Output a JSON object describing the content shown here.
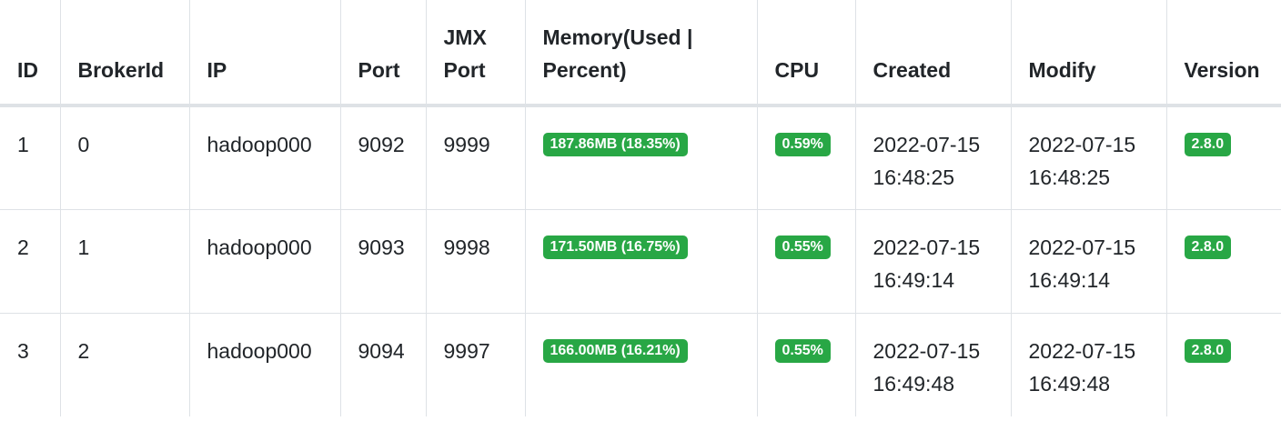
{
  "table": {
    "headers": {
      "id": "ID",
      "broker_id": "BrokerId",
      "ip": "IP",
      "port": "Port",
      "jmx_port": "JMX\nPort",
      "memory": "Memory(Used |\nPercent)",
      "cpu": "CPU",
      "created": "Created",
      "modify": "Modify",
      "version": "Version"
    },
    "rows": [
      {
        "id": "1",
        "broker_id": "0",
        "ip": "hadoop000",
        "port": "9092",
        "jmx_port": "9999",
        "memory": "187.86MB (18.35%)",
        "cpu": "0.59%",
        "created": "2022-07-15\n16:48:25",
        "modify": "2022-07-15\n16:48:25",
        "version": "2.8.0"
      },
      {
        "id": "2",
        "broker_id": "1",
        "ip": "hadoop000",
        "port": "9093",
        "jmx_port": "9998",
        "memory": "171.50MB (16.75%)",
        "cpu": "0.55%",
        "created": "2022-07-15\n16:49:14",
        "modify": "2022-07-15\n16:49:14",
        "version": "2.8.0"
      },
      {
        "id": "3",
        "broker_id": "2",
        "ip": "hadoop000",
        "port": "9094",
        "jmx_port": "9997",
        "memory": "166.00MB (16.21%)",
        "cpu": "0.55%",
        "created": "2022-07-15\n16:49:48",
        "modify": "2022-07-15\n16:49:48",
        "version": "2.8.0"
      }
    ]
  },
  "colors": {
    "badge_success": "#28a745",
    "border": "#dee2e6",
    "text": "#212529"
  }
}
